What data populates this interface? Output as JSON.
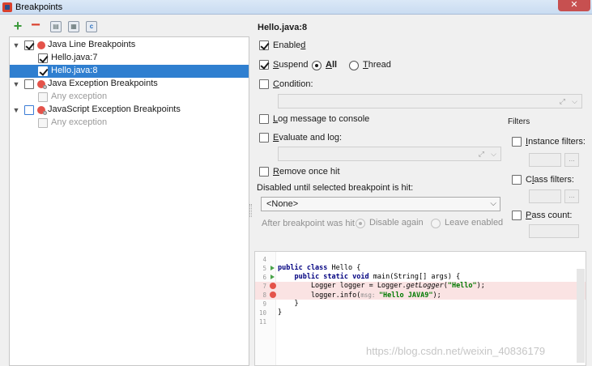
{
  "window": {
    "title": "Breakpoints",
    "close": "✕"
  },
  "toolbar": {
    "add": "+",
    "remove": "−",
    "group_package": "▤",
    "group_file": "▦",
    "group_class": "c"
  },
  "tree": {
    "java_line": {
      "label": "Java Line Breakpoints",
      "children": [
        "Hello.java:7",
        "Hello.java:8"
      ]
    },
    "java_exception": {
      "label": "Java Exception Breakpoints",
      "child": "Any exception"
    },
    "js_exception": {
      "label": "JavaScript Exception Breakpoints",
      "child": "Any exception"
    }
  },
  "details": {
    "title": "Hello.java:8",
    "enabled": {
      "pre": "Enable",
      "acc": "d"
    },
    "suspend": {
      "acc": "S",
      "rest": "uspend"
    },
    "all": {
      "acc": "A",
      "rest": "ll"
    },
    "thread": {
      "acc": "T",
      "rest": "hread"
    },
    "condition": {
      "acc": "C",
      "rest": "ondition:"
    },
    "log_message": {
      "acc": "L",
      "rest": "og message to console"
    },
    "evaluate": {
      "acc": "E",
      "rest": "valuate and log:"
    },
    "remove_once": {
      "acc": "R",
      "rest": "emove once hit"
    },
    "disabled_until": "Disabled until selected breakpoint is hit:",
    "none_value": "<None>",
    "after_hit": "After breakpoint was hit",
    "disable_again": "Disable again",
    "leave_enabled": "Leave enabled"
  },
  "filters": {
    "label": "Filters",
    "instance": {
      "acc": "I",
      "rest": "nstance filters:"
    },
    "class": {
      "pre": "C",
      "acc": "l",
      "rest": "ass filters:"
    },
    "pass": {
      "acc": "P",
      "rest": "ass count:"
    },
    "more": "..."
  },
  "editor": {
    "lines": [
      {
        "n": "4",
        "text": ""
      },
      {
        "n": "5",
        "kw1": "public class ",
        "rest": "Hello {"
      },
      {
        "n": "6",
        "pre": "    ",
        "kw1": "public static void ",
        "rest": "main(String[] args) {"
      },
      {
        "n": "7",
        "pre": "        Logger logger = Logger.",
        "ital": "getLogger",
        "str": "\"Hello\"",
        "post": ");"
      },
      {
        "n": "8",
        "pre": "        logger.info(",
        "hint": "msg: ",
        "str": "\"Hello JAVA9\"",
        "post": ");"
      },
      {
        "n": "9",
        "text": "    }"
      },
      {
        "n": "10",
        "text": "}"
      },
      {
        "n": "11",
        "text": ""
      }
    ]
  },
  "watermark": "https://blog.csdn.net/weixin_40836179"
}
